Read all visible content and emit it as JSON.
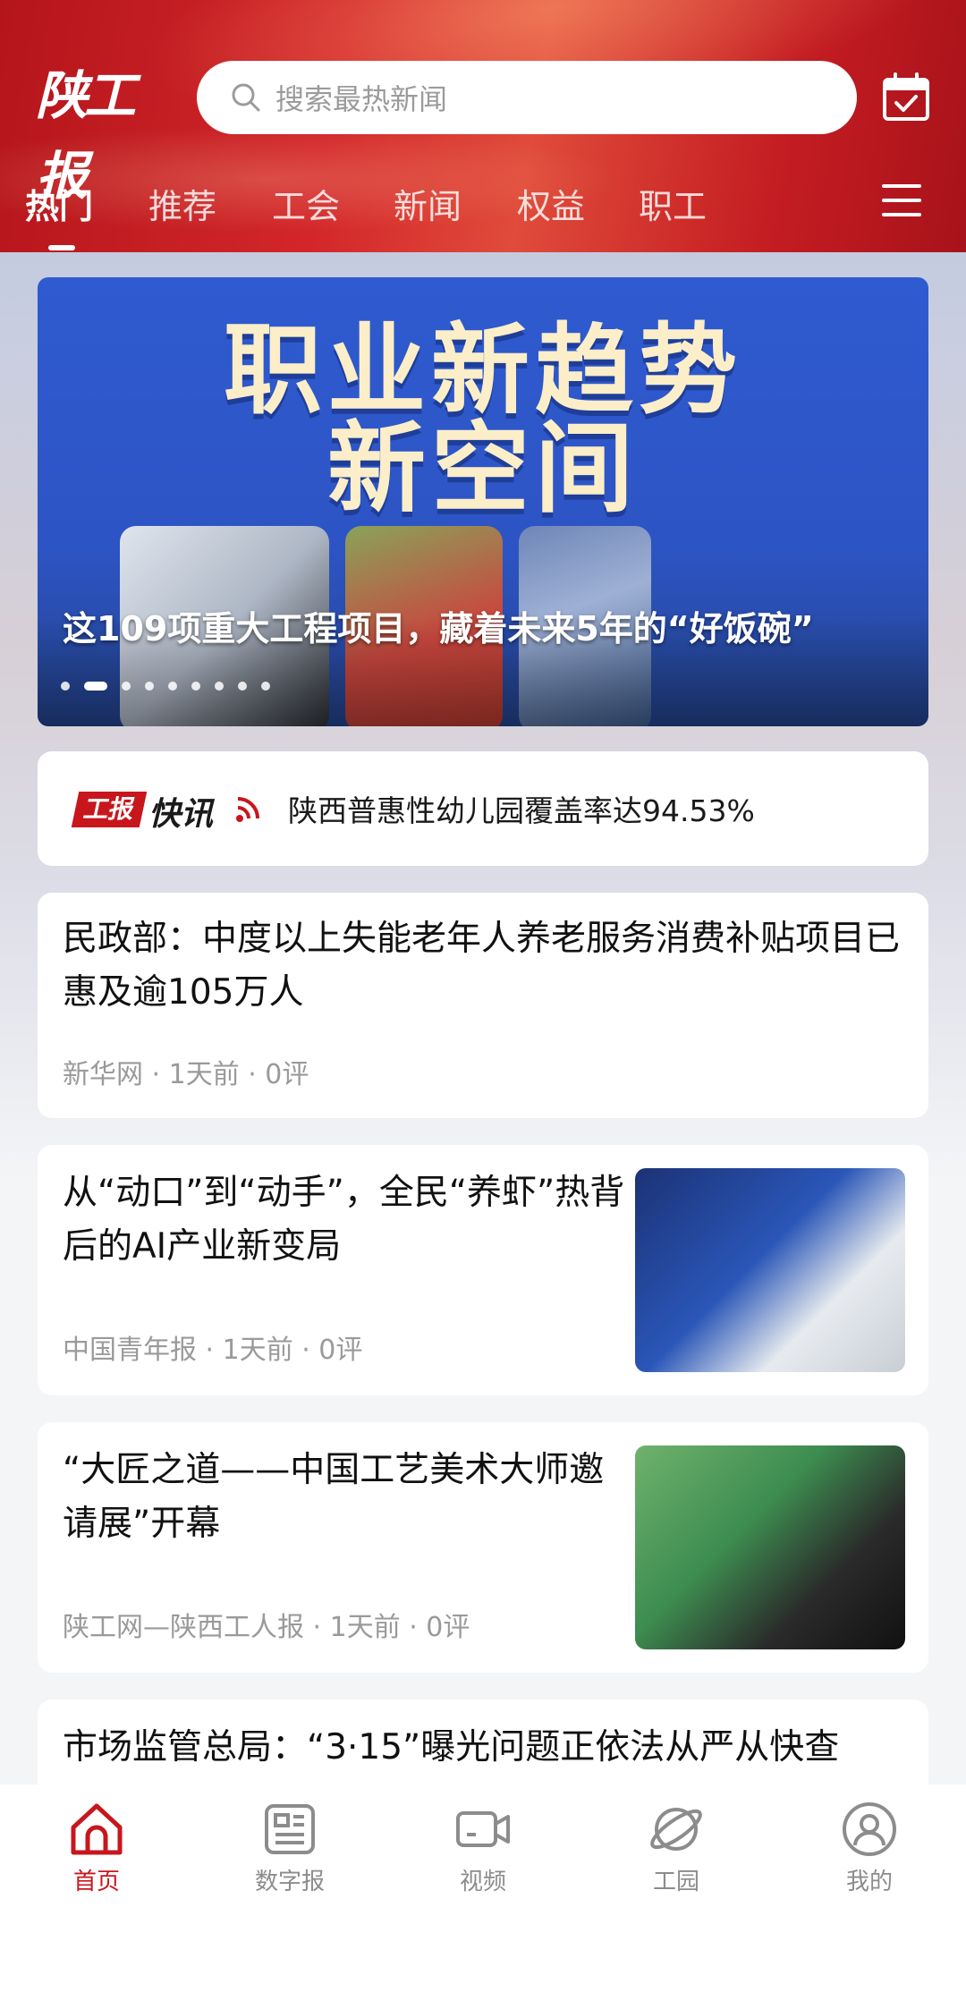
{
  "header": {
    "logo_text": "陕工报",
    "search_placeholder": "搜索最热新闻",
    "tabs": [
      "热门",
      "推荐",
      "工会",
      "新闻",
      "权益",
      "职工"
    ],
    "active_tab": "热门"
  },
  "banner": {
    "headline_line1": "职业新趋势",
    "headline_line2": "新空间",
    "caption": "这109项重大工程项目，藏着未来5年的“好饭碗”",
    "dot_count": 9,
    "active_dot": 1
  },
  "flash": {
    "logo_box": "工报",
    "logo_text": "快讯",
    "text": "陕西普惠性幼儿园覆盖率达94.53%"
  },
  "news": [
    {
      "title": "民政部：中度以上失能老年人养老服务消费补贴项目已惠及逾105万人",
      "meta": "新华网 · 1天前 · 0评"
    },
    {
      "title": "从“动口”到“动手”，全民“养虾”热背后的AI产业新变局",
      "meta": "中国青年报 · 1天前 · 0评"
    },
    {
      "title": "“大匠之道——中国工艺美术大师邀请展”开幕",
      "meta": "陕工网—陕西工人报 · 1天前 · 0评"
    },
    {
      "title": "市场监管总局：“3·15”曝光问题正依法从严从快查"
    }
  ],
  "bottom_nav": [
    {
      "label": "首页",
      "icon": "home-icon",
      "active": true
    },
    {
      "label": "数字报",
      "icon": "newspaper-icon",
      "active": false
    },
    {
      "label": "视频",
      "icon": "video-icon",
      "active": false
    },
    {
      "label": "工园",
      "icon": "planet-icon",
      "active": false
    },
    {
      "label": "我的",
      "icon": "profile-icon",
      "active": false
    }
  ],
  "colors": {
    "brand_red": "#c8161d",
    "header_red": "#d3262a",
    "banner_blue": "#2f5bd0"
  }
}
